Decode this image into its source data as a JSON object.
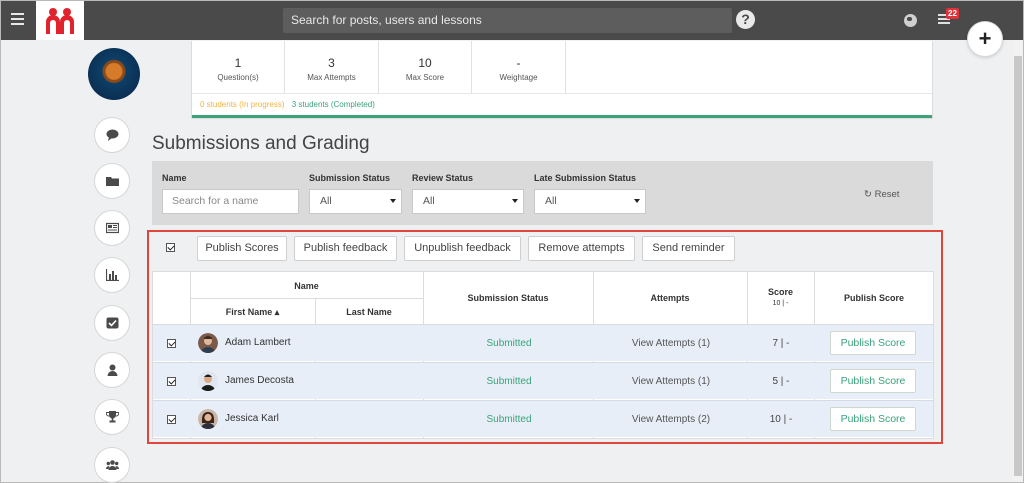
{
  "topbar": {
    "search_placeholder": "Search for posts, users and lessons",
    "help_glyph": "?",
    "notification_count": "22",
    "plus_glyph": "+"
  },
  "stats": [
    {
      "value": "1",
      "label": "Question(s)"
    },
    {
      "value": "3",
      "label": "Max Attempts"
    },
    {
      "value": "10",
      "label": "Max Score"
    },
    {
      "value": "-",
      "label": "Weightage"
    }
  ],
  "progress": {
    "in_progress": "0 students (In progress)",
    "completed": "3 students (Completed)"
  },
  "section_title": "Submissions and Grading",
  "filters": {
    "name_label": "Name",
    "name_placeholder": "Search for a name",
    "submission_status_label": "Submission Status",
    "submission_status_value": "All",
    "review_status_label": "Review Status",
    "review_status_value": "All",
    "late_status_label": "Late Submission Status",
    "late_status_value": "All",
    "reset_label": "Reset"
  },
  "toolbar": {
    "publish_scores": "Publish Scores",
    "publish_feedback": "Publish feedback",
    "unpublish_feedback": "Unpublish feedback",
    "remove_attempts": "Remove attempts",
    "send_reminder": "Send reminder"
  },
  "table": {
    "name_group": "Name",
    "first_name": "First Name ▴",
    "last_name": "Last Name",
    "submission_status": "Submission Status",
    "attempts": "Attempts",
    "score": "Score",
    "score_sub": "10 | -",
    "publish_score": "Publish Score",
    "rows": [
      {
        "name": "Adam Lambert",
        "status": "Submitted",
        "attempts": "View Attempts (1)",
        "score": "7 | -",
        "publish": "Publish Score"
      },
      {
        "name": "James Decosta",
        "status": "Submitted",
        "attempts": "View Attempts (1)",
        "score": "5 | -",
        "publish": "Publish Score"
      },
      {
        "name": "Jessica Karl",
        "status": "Submitted",
        "attempts": "View Attempts (2)",
        "score": "10 | -",
        "publish": "Publish Score"
      }
    ]
  },
  "sidebar_icons": [
    "chat-icon",
    "folder-icon",
    "newspaper-icon",
    "bar-chart-icon",
    "checkbox-icon",
    "user-icon",
    "trophy-icon",
    "group-icon"
  ],
  "colors": {
    "accent_green": "#3ba27a",
    "in_progress_yellow": "#f0b441",
    "highlight_red": "#e0463c",
    "topbar": "#4a4a4a"
  }
}
